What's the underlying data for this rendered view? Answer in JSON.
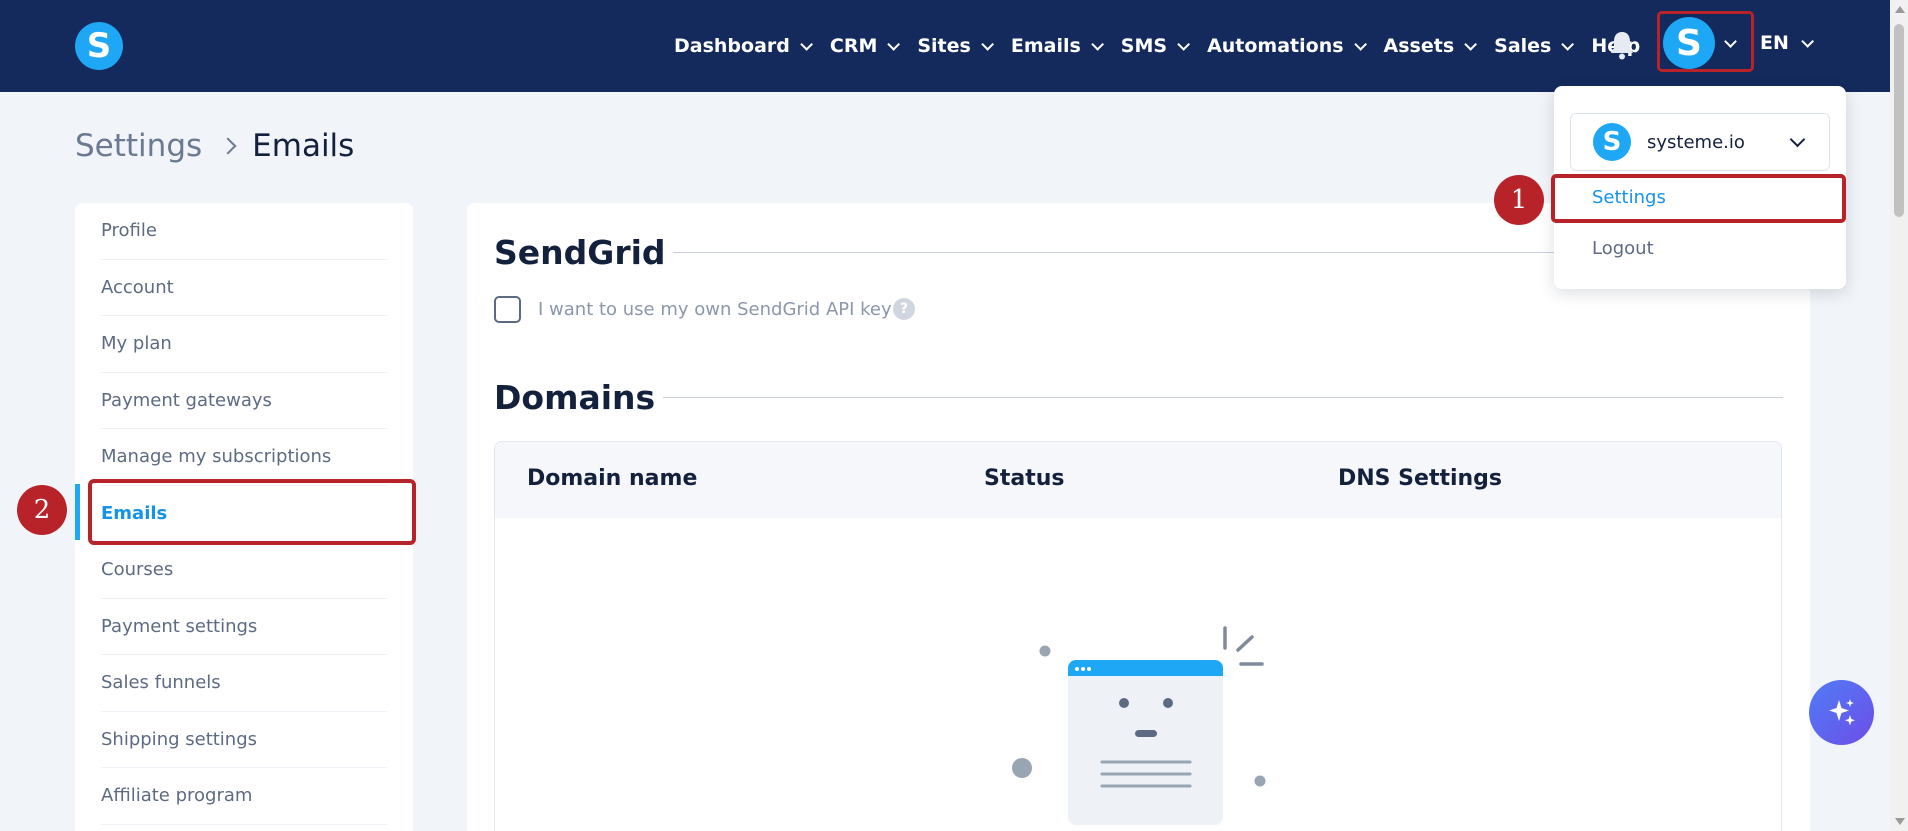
{
  "nav": {
    "items": [
      {
        "label": "Dashboard",
        "has_dropdown": true
      },
      {
        "label": "CRM",
        "has_dropdown": true
      },
      {
        "label": "Sites",
        "has_dropdown": true
      },
      {
        "label": "Emails",
        "has_dropdown": true
      },
      {
        "label": "SMS",
        "has_dropdown": true
      },
      {
        "label": "Automations",
        "has_dropdown": true
      },
      {
        "label": "Assets",
        "has_dropdown": true
      },
      {
        "label": "Sales",
        "has_dropdown": true
      },
      {
        "label": "Help",
        "has_dropdown": false
      }
    ],
    "logo_letter": "S",
    "avatar_letter": "S",
    "language": "EN",
    "icons": {
      "notifications": "bell-icon"
    }
  },
  "breadcrumb": {
    "parent": "Settings",
    "current": "Emails"
  },
  "sidebar": {
    "items": [
      {
        "label": "Profile"
      },
      {
        "label": "Account"
      },
      {
        "label": "My plan"
      },
      {
        "label": "Payment gateways"
      },
      {
        "label": "Manage my subscriptions"
      },
      {
        "label": "Emails",
        "active": true
      },
      {
        "label": "Courses"
      },
      {
        "label": "Payment settings"
      },
      {
        "label": "Sales funnels"
      },
      {
        "label": "Shipping settings"
      },
      {
        "label": "Affiliate program"
      }
    ]
  },
  "main": {
    "sendgrid_title": "SendGrid",
    "sendgrid_checkbox_label": "I want to use my own SendGrid API key",
    "sendgrid_checked": false,
    "help_symbol": "?",
    "domains_title": "Domains",
    "table_headers": [
      "Domain name",
      "Status",
      "DNS Settings"
    ]
  },
  "dropdown": {
    "account_name": "systeme.io",
    "account_logo_letter": "S",
    "settings_label": "Settings",
    "logout_label": "Logout"
  },
  "annotations": {
    "badge_1": "1",
    "badge_2": "2"
  },
  "colors": {
    "nav_bg": "#142a5c",
    "brand_blue": "#1ea7f4",
    "link_blue": "#1593e6",
    "highlight_red": "#b8232a"
  }
}
